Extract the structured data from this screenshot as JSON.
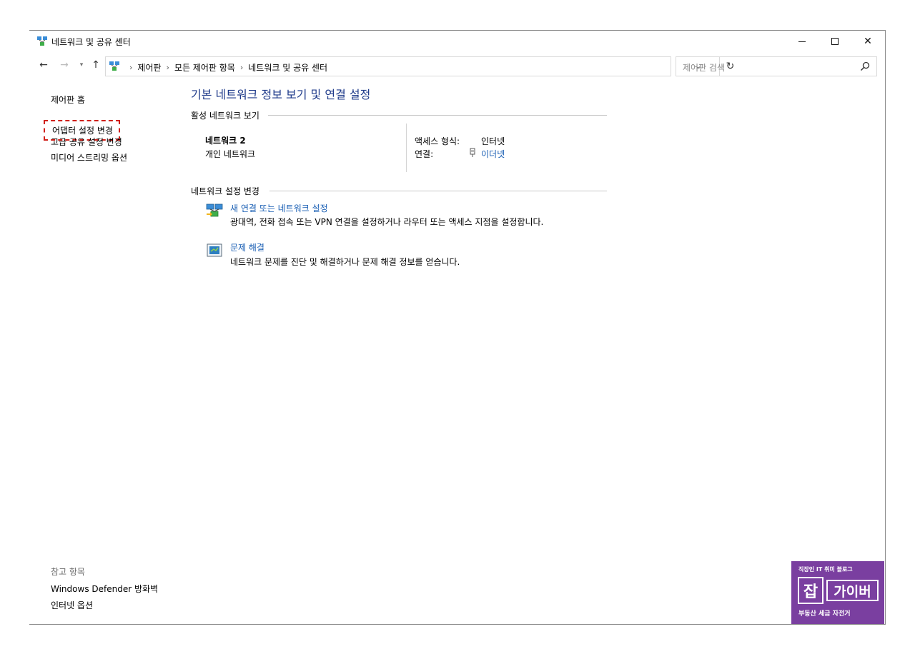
{
  "window": {
    "title": "네트워크 및 공유 센터",
    "controls": {
      "minimize": "minimize",
      "maximize": "maximize",
      "close": "✕"
    }
  },
  "nav": {
    "breadcrumbs": [
      "제어판",
      "모든 제어판 항목",
      "네트워크 및 공유 센터"
    ],
    "search_placeholder": "제어판 검색"
  },
  "left_pane": {
    "home": "제어판 홈",
    "adapter": "어댑터 설정 변경",
    "advanced_sharing": "고급 공유 설정 변경",
    "media_streaming": "미디어 스트리밍 옵션",
    "see_also_header": "참고 항목",
    "firewall": "Windows Defender 방화벽",
    "internet_options": "인터넷 옵션"
  },
  "main": {
    "title": "기본 네트워크 정보 보기 및 연결 설정",
    "active_networks_header": "활성 네트워크 보기",
    "network": {
      "name": "네트워크 2",
      "type": "개인 네트워크",
      "access_label": "액세스 형식:",
      "access_value": "인터넷",
      "connection_label": "연결:",
      "connection_value": "이더넷"
    },
    "change_settings_header": "네트워크 설정 변경",
    "tasks": [
      {
        "link": "새 연결 또는 네트워크 설정",
        "description": "광대역, 전화 접속 또는 VPN 연결을 설정하거나 라우터 또는 액세스 지점을 설정합니다."
      },
      {
        "link": "문제 해결",
        "description": "네트워크 문제를 진단 및 해결하거나 문제 해결 정보를 얻습니다."
      }
    ]
  },
  "watermark": {
    "top": "직장인 IT 취미 블로그",
    "char1": "잡",
    "char2": "가이버",
    "bottom": "부동산 세금 자전거"
  },
  "colors": {
    "link": "#1a5fb4",
    "title": "#1e3a8a",
    "highlight_border": "#d0201a",
    "badge": "#7a3fa0"
  }
}
